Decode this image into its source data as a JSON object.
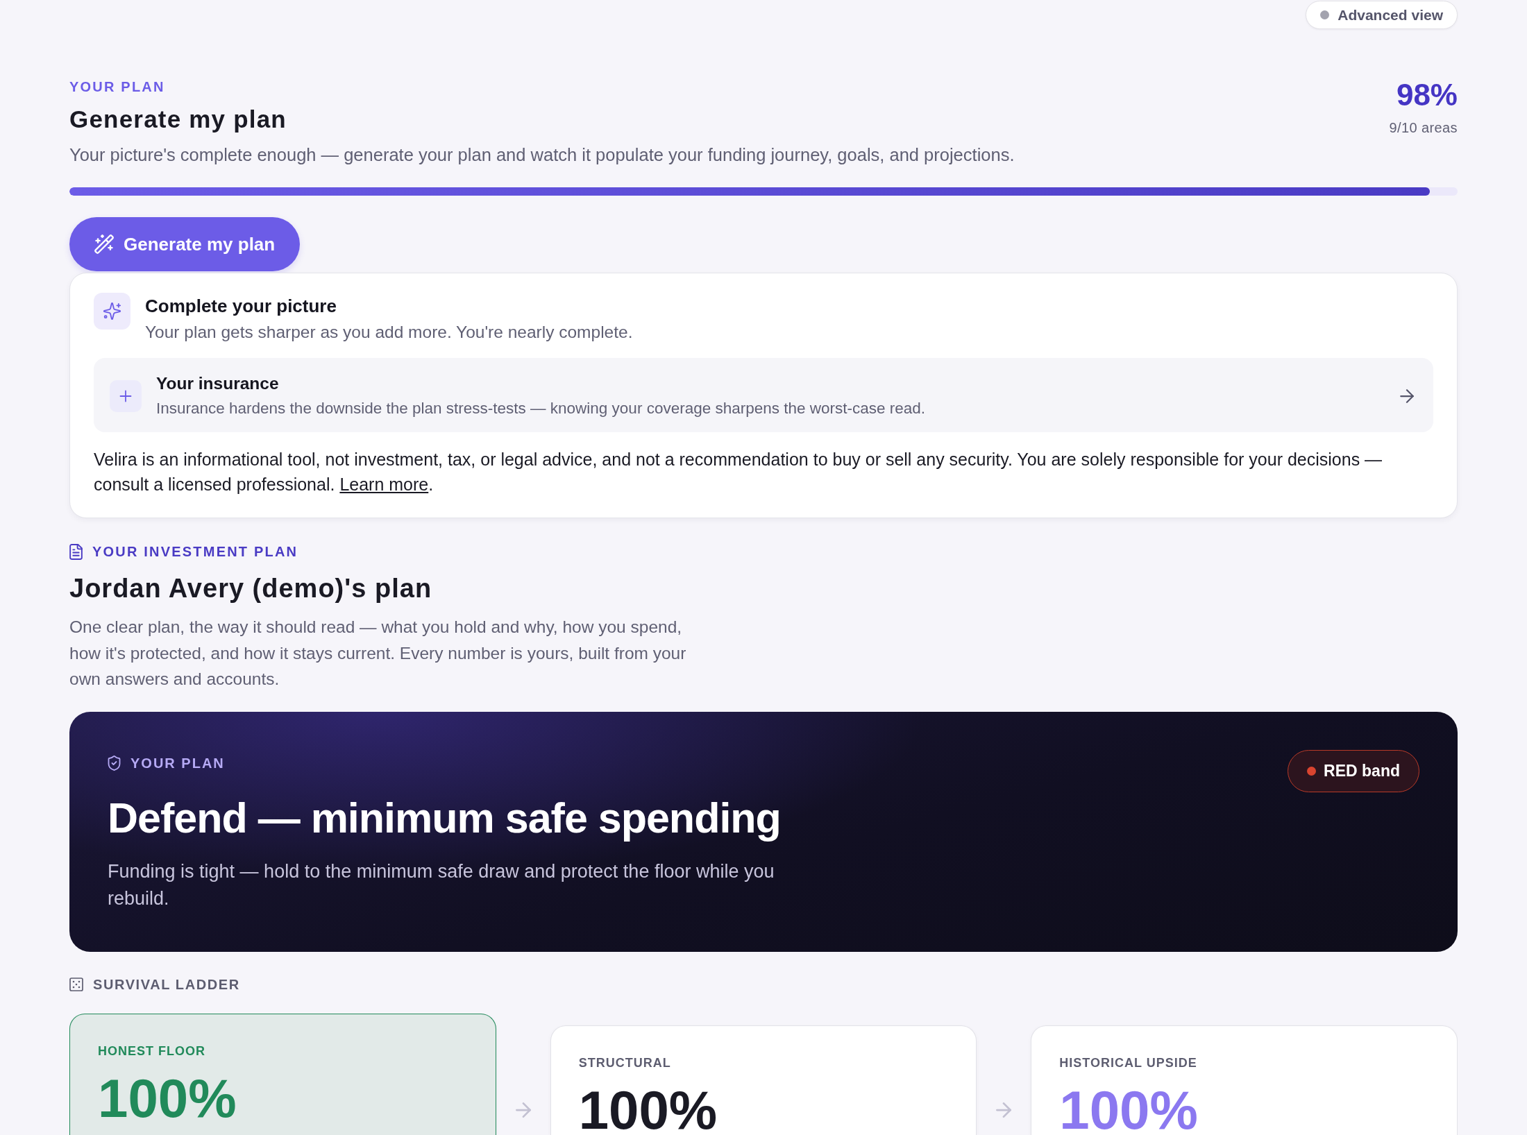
{
  "toolbar": {
    "advanced_view": {
      "label": "Advanced view",
      "on": false
    }
  },
  "plan": {
    "eyebrow": "YOUR PLAN",
    "title": "Generate my plan",
    "description": "Your picture's complete enough — generate your plan and watch it populate your funding journey, goals, and projections.",
    "completion": {
      "percent": "98%",
      "areas": "9/10 areas",
      "level": 0.98
    },
    "generate_button": "Generate my plan"
  },
  "completion_card": {
    "title": "Complete your picture",
    "subtitle": "Your plan gets sharper as you add more. You're nearly complete.",
    "items": [
      {
        "title": "Your insurance",
        "description": "Insurance hardens the downside the plan stress-tests — knowing your coverage sharpens the worst-case read."
      }
    ],
    "disclaimer": {
      "text": "Velira is an informational tool, not investment, tax, or legal advice, and not a recommendation to buy or sell any security. You are solely responsible for your decisions — consult a licensed professional.",
      "link": "Learn more",
      "after": "."
    }
  },
  "investment_plan": {
    "eyebrow": "YOUR INVESTMENT PLAN",
    "title": "Jordan Avery (demo)'s plan",
    "description": "One clear plan, the way it should read — what you hold and why, how you spend, how it's protected, and how it stays current. Every number is yours, built from your own answers and accounts."
  },
  "banner": {
    "eyebrow": "YOUR PLAN",
    "title": "Defend — minimum safe spending",
    "description": "Funding is tight — hold to the minimum safe draw and protect the floor while you rebuild.",
    "band": {
      "label": "RED band",
      "color": "#d9442f"
    }
  },
  "survival_ladder": {
    "title": "SURVIVAL LADDER",
    "rungs": [
      {
        "label": "HONEST FLOOR",
        "value": "100%",
        "selected": true,
        "color": "#218a5a"
      },
      {
        "label": "STRUCTURAL",
        "value": "100%",
        "selected": false,
        "color": "#1a1a24"
      },
      {
        "label": "HISTORICAL UPSIDE",
        "value": "100%",
        "selected": false,
        "color": "#8b78f0"
      }
    ]
  }
}
